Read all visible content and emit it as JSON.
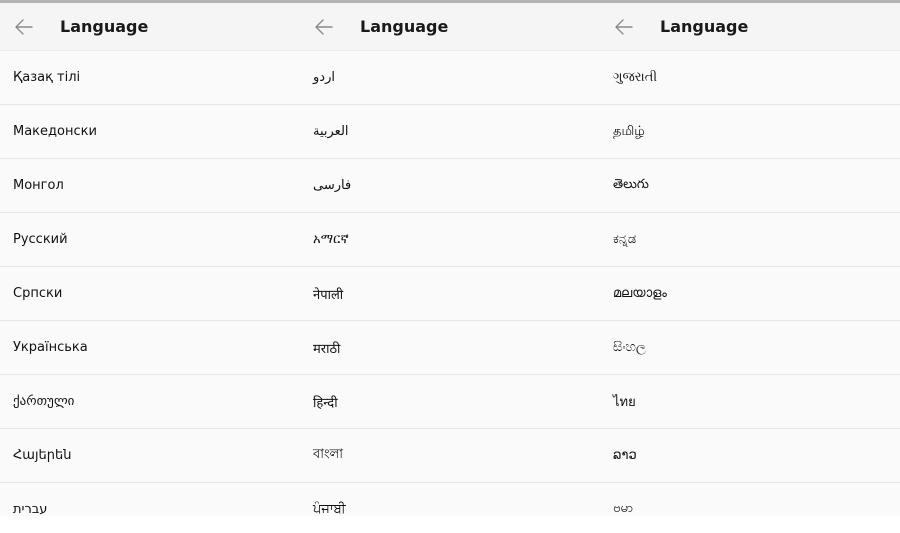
{
  "screens": [
    {
      "title": "Language",
      "languages": [
        "Қазақ тілі",
        "Македонски",
        "Монгол",
        "Русский",
        "Српски",
        "Українська",
        "ქართული",
        "Հայերեն",
        "עברית"
      ]
    },
    {
      "title": "Language",
      "languages": [
        "اردو",
        "العربية",
        "فارسی",
        "አማርኛ",
        "नेपाली",
        "मराठी",
        "हिन्दी",
        "বাংলা",
        "ਪੰਜਾਬੀ"
      ]
    },
    {
      "title": "Language",
      "languages": [
        "ગુજરાતી",
        "தமிழ்",
        "తెలుగు",
        "ಕನ್ನಡ",
        "മലയാളം",
        "සිංහල",
        "ไทย",
        "ລາວ",
        "ဗမာ"
      ]
    }
  ],
  "icons": {
    "back": "arrow-left-icon"
  },
  "colors": {
    "appbar_bg": "#f5f5f5",
    "list_bg": "#fafafa",
    "divider": "#e6e6e6",
    "text": "#111111"
  }
}
